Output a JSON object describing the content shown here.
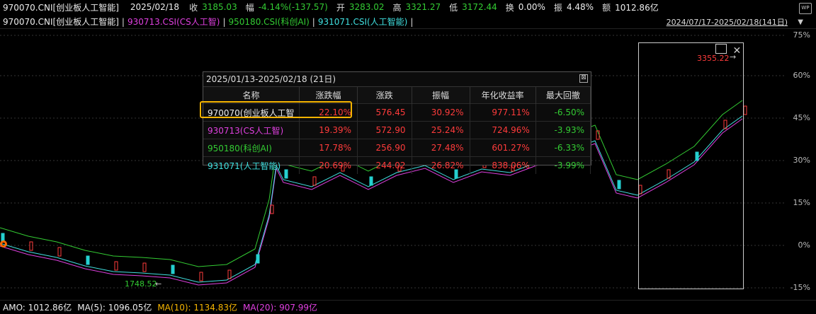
{
  "header": {
    "code_name": "970070.CNI[创业板人工智能]",
    "date": "2025/02/18",
    "close_label": "收",
    "close_value": "3185.03",
    "change_label": "幅",
    "change_value": "-4.14%(-137.57)",
    "open_label": "开",
    "open_value": "3283.02",
    "high_label": "高",
    "high_value": "3321.27",
    "low_label": "低",
    "low_value": "3172.44",
    "turnover_label": "换",
    "turnover_value": "0.00%",
    "amplitude_label": "振",
    "amplitude_value": "4.48%",
    "amount_label": "额",
    "amount_value": "1012.86亿",
    "wp_badge": "WP"
  },
  "legend": {
    "s1": "970070.CNI[创业板人工智能]",
    "s2": "930713.CSI(CS人工智)",
    "s3": "950180.CSI(科创AI)",
    "s4": "931071.CSI(人工智能)",
    "sep": "|",
    "range": "2024/07/17-2025/02/18(141日)",
    "dropdown": "▼"
  },
  "colors": {
    "up": "#ff3b3b",
    "down": "#25d0d0",
    "green": "#33cc33",
    "magenta": "#e040e0",
    "cyan": "#40e0e0",
    "yellow": "#f5b400"
  },
  "y_axis": [
    "75%",
    "60%",
    "45%",
    "30%",
    "15%",
    "0%",
    "-15%"
  ],
  "annotations": {
    "high": "3355.22",
    "low": "1748.52"
  },
  "popup": {
    "title": "2025/01/13-2025/02/18 (21日)",
    "close_icon": "⊠",
    "columns": [
      "名称",
      "涨跌幅",
      "涨跌",
      "振幅",
      "年化收益率",
      "最大回撤"
    ],
    "rows": [
      {
        "name": "970070(创业板人工智",
        "pct": "22.10%",
        "chg": "576.45",
        "amp": "30.92%",
        "ann": "977.11%",
        "dd": "-6.50%"
      },
      {
        "name": "930713(CS人工智)",
        "pct": "19.39%",
        "chg": "572.90",
        "amp": "25.24%",
        "ann": "724.96%",
        "dd": "-3.93%"
      },
      {
        "name": "950180(科创AI)",
        "pct": "17.78%",
        "chg": "256.90",
        "amp": "27.48%",
        "ann": "601.27%",
        "dd": "-6.33%"
      },
      {
        "name": "931071(人工智能)",
        "pct": "20.69%",
        "chg": "244.02",
        "amp": "26.82%",
        "ann": "838.06%",
        "dd": "-3.99%"
      }
    ]
  },
  "footer": {
    "amo": "AMO: 1012.86亿",
    "ma5": "MA(5): 1096.05亿",
    "ma10": "MA(10): 1134.83亿",
    "ma20": "MA(20): 907.99亿"
  }
}
